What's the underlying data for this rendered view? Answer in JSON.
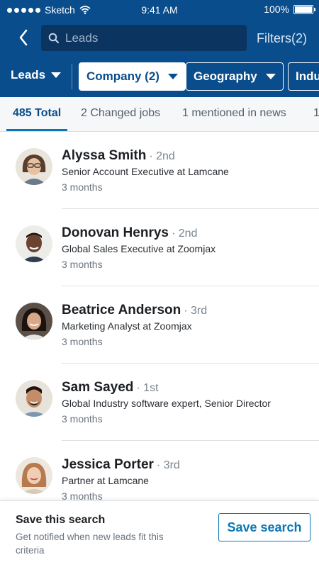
{
  "status_bar": {
    "carrier": "Sketch",
    "time": "9:41 AM",
    "battery": "100%"
  },
  "header": {
    "search_placeholder": "Leads",
    "filters_label": "Filters(2)",
    "leads_dropdown_label": "Leads",
    "chips": [
      {
        "label": "Company (2)",
        "active": true
      },
      {
        "label": "Geography",
        "active": false
      },
      {
        "label": "Indu",
        "active": false
      }
    ]
  },
  "tabs": [
    {
      "label": "485 Total",
      "active": true
    },
    {
      "label": "2 Changed jobs",
      "active": false
    },
    {
      "label": "1 mentioned in news",
      "active": false
    },
    {
      "label": "1",
      "active": false
    }
  ],
  "leads": [
    {
      "name": "Alyssa Smith",
      "degree": "· 2nd",
      "title": "Senior Account Executive at Lamcane",
      "time": "3 months",
      "avatar": "avatar-alyssa"
    },
    {
      "name": "Donovan Henrys",
      "degree": "· 2nd",
      "title": "Global Sales Executive at Zoomjax",
      "time": "3 months",
      "avatar": "avatar-donovan"
    },
    {
      "name": "Beatrice Anderson",
      "degree": "· 3rd",
      "title": "Marketing Analyst at Zoomjax",
      "time": "3 months",
      "avatar": "avatar-beatrice"
    },
    {
      "name": "Sam Sayed",
      "degree": "· 1st",
      "title": "Global Industry software expert, Senior Director",
      "time": "3 months",
      "avatar": "avatar-sam"
    },
    {
      "name": "Jessica Porter",
      "degree": "· 3rd",
      "title": "Partner at Lamcane",
      "time": "3 months",
      "avatar": "avatar-jessica"
    }
  ],
  "bottom_bar": {
    "title": "Save this search",
    "description": "Get notified when new leads fit this criteria",
    "button_label": "Save search"
  },
  "colors": {
    "header_bg": "#0a4d8c",
    "accent": "#0a77b5"
  }
}
